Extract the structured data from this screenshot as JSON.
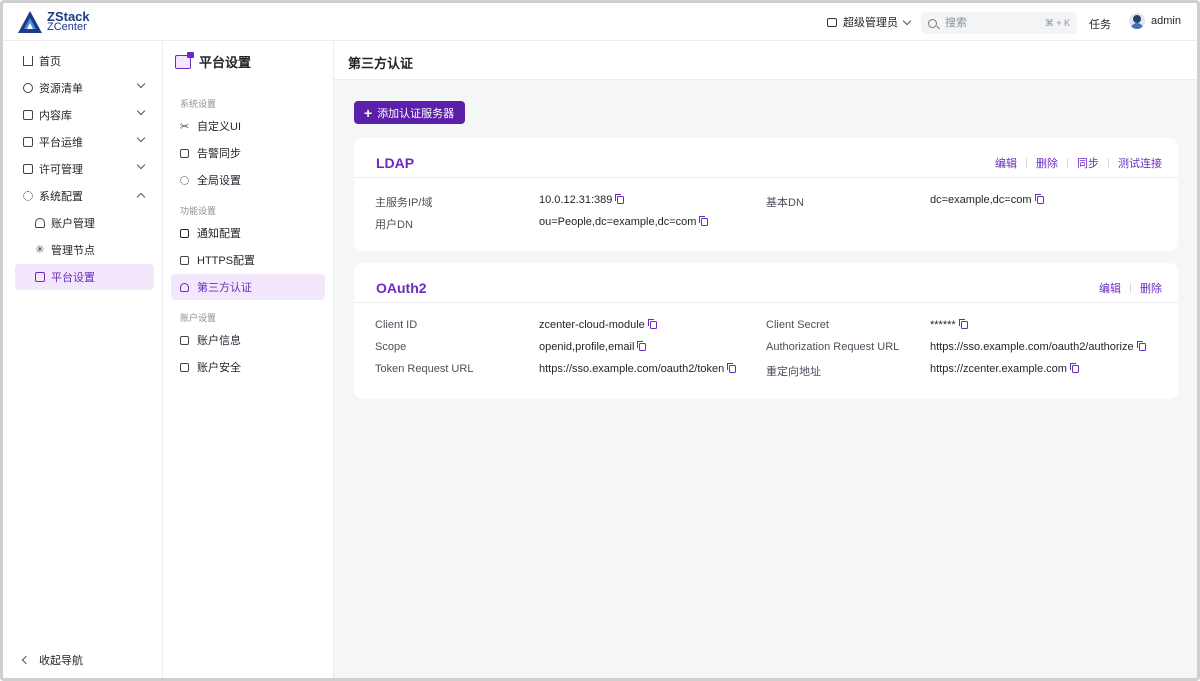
{
  "header": {
    "logo_line1": "ZStack",
    "logo_line2": "ZCenter",
    "role_label": "超级管理员",
    "search_placeholder": "搜索",
    "search_shortcut": "⌘ + K",
    "tasks_label": "任务",
    "user_name": "admin"
  },
  "sidebar": {
    "items": [
      {
        "label": "首页",
        "icon": "home-icon"
      },
      {
        "label": "资源清单",
        "icon": "globe-icon"
      },
      {
        "label": "内容库",
        "icon": "library-icon"
      },
      {
        "label": "平台运维",
        "icon": "ops-icon"
      },
      {
        "label": "许可管理",
        "icon": "license-icon"
      },
      {
        "label": "系统配置",
        "icon": "gear-icon"
      }
    ],
    "sub_items": [
      {
        "label": "账户管理",
        "icon": "user-icon"
      },
      {
        "label": "管理节点",
        "icon": "asterisk-icon"
      },
      {
        "label": "平台设置",
        "icon": "mail-icon"
      }
    ],
    "collapse_label": "收起导航"
  },
  "subnav": {
    "title": "平台设置",
    "groups": [
      {
        "label": "系统设置",
        "items": [
          "自定义UI",
          "告警同步",
          "全局设置"
        ]
      },
      {
        "label": "功能设置",
        "items": [
          "通知配置",
          "HTTPS配置",
          "第三方认证"
        ]
      },
      {
        "label": "账户设置",
        "items": [
          "账户信息",
          "账户安全"
        ]
      }
    ]
  },
  "main": {
    "title": "第三方认证",
    "add_button": "添加认证服务器",
    "ldap": {
      "title": "LDAP",
      "actions": [
        "编辑",
        "删除",
        "同步",
        "测试连接"
      ],
      "fields": [
        {
          "label": "主服务IP/域",
          "value": "10.0.12.31:389"
        },
        {
          "label": "基本DN",
          "value": "dc=example,dc=com"
        },
        {
          "label": "用户DN",
          "value": "ou=People,dc=example,dc=com"
        }
      ]
    },
    "oauth2": {
      "title": "OAuth2",
      "actions": [
        "编辑",
        "删除"
      ],
      "fields": [
        {
          "label": "Client ID",
          "value": "zcenter-cloud-module"
        },
        {
          "label": "Client Secret",
          "value": "******"
        },
        {
          "label": "Scope",
          "value": "openid,profile,email"
        },
        {
          "label": "Authorization Request URL",
          "value": "https://sso.example.com/oauth2/authorize"
        },
        {
          "label": "Token Request URL",
          "value": "https://sso.example.com/oauth2/token"
        },
        {
          "label": "重定向地址",
          "value": "https://zcenter.example.com"
        }
      ]
    }
  },
  "colors": {
    "accent": "#6b2bbf",
    "button": "#5b1faa",
    "active_bg": "#f3e8fb",
    "brand": "#1d3a8a"
  }
}
